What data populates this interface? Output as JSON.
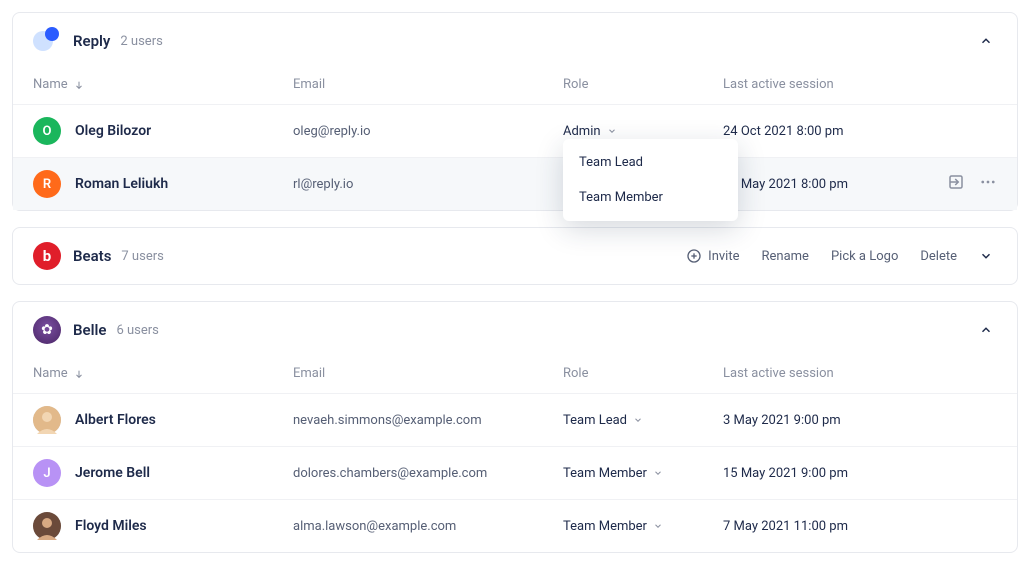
{
  "columns": {
    "name": "Name",
    "email": "Email",
    "role": "Role",
    "last": "Last active session"
  },
  "dropdown": [
    "Team Lead",
    "Team Member"
  ],
  "teams": [
    {
      "name": "Reply",
      "count": "2 users",
      "expanded": true,
      "actions": false,
      "rows": [
        {
          "avatar_bg": "#1ab65c",
          "initial": "O",
          "name": "Oleg Bilozor",
          "email": "oleg@reply.io",
          "role": "Admin",
          "last": "24 Oct 2021 8:00 pm",
          "hl": false,
          "show_dropdown": true,
          "extras": false
        },
        {
          "avatar_bg": "#ff6a1a",
          "initial": "R",
          "name": "Roman Leliukh",
          "email": "rl@reply.io",
          "role": "",
          "last": "15 May 2021 8:00 pm",
          "hl": true,
          "show_dropdown": false,
          "extras": true
        }
      ]
    },
    {
      "name": "Beats",
      "count": "7 users",
      "expanded": false,
      "actions": true,
      "actions_list": {
        "invite": "Invite",
        "rename": "Rename",
        "pick": "Pick a Logo",
        "delete": "Delete"
      }
    },
    {
      "name": "Belle",
      "count": "6 users",
      "expanded": true,
      "actions": false,
      "rows": [
        {
          "photo": "af",
          "name": "Albert Flores",
          "email": "nevaeh.simmons@example.com",
          "role": "Team Lead",
          "last": "3 May 2021 9:00 pm",
          "extras": false
        },
        {
          "avatar_bg": "#b892f5",
          "initial": "J",
          "name": "Jerome Bell",
          "email": "dolores.chambers@example.com",
          "role": "Team Member",
          "last": "15 May 2021 9:00 pm",
          "extras": false
        },
        {
          "photo": "fm",
          "name": "Floyd Miles",
          "email": "alma.lawson@example.com",
          "role": "Team Member",
          "last": "7 May 2021 11:00 pm",
          "extras": false
        }
      ]
    }
  ]
}
